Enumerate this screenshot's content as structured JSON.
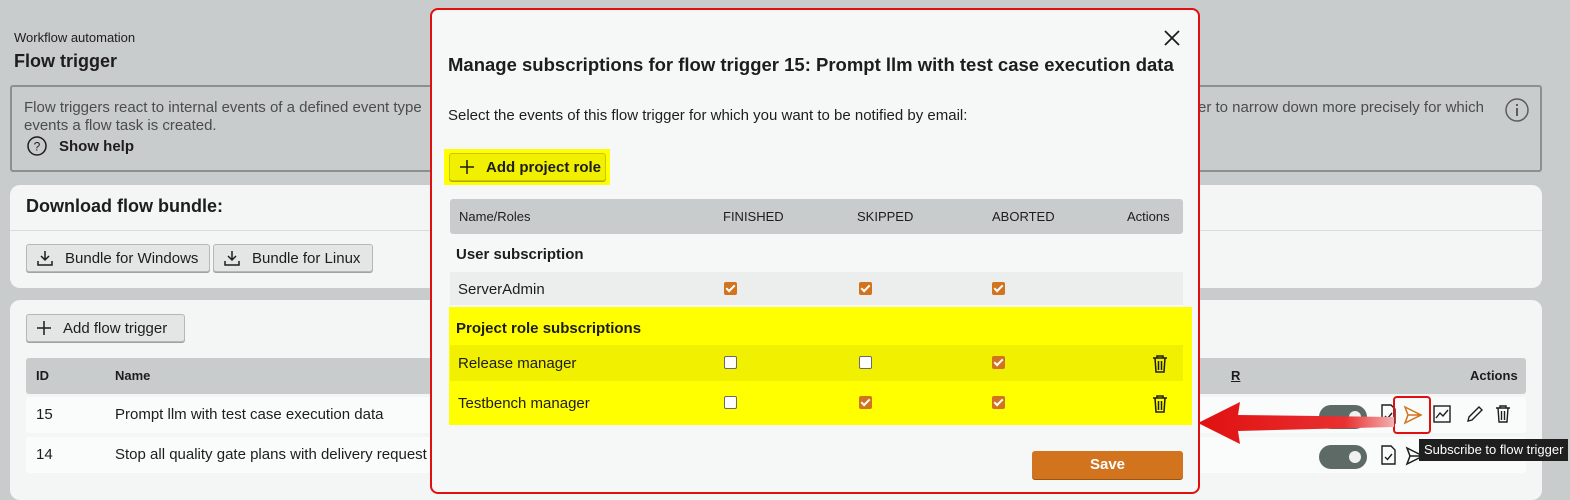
{
  "page": {
    "breadcrumb": "Workflow automation",
    "title": "Flow trigger",
    "info_text_line1_left": "Flow triggers react to internal events of a defined event type",
    "info_text_line1_right": "er to narrow down more precisely for which",
    "info_text_line2": "events a flow task is created.",
    "show_help": "Show help"
  },
  "download": {
    "heading": "Download flow bundle:",
    "windows_label": "Bundle for Windows",
    "linux_label": "Bundle for Linux"
  },
  "triggers": {
    "add_label": "Add flow trigger",
    "columns": {
      "id": "ID",
      "name": "Name",
      "r": "R",
      "actions": "Actions"
    },
    "rows": [
      {
        "id": "15",
        "name": "Prompt llm with test case execution data"
      },
      {
        "id": "14",
        "name": "Stop all quality gate plans with delivery request"
      }
    ],
    "tooltip": "Subscribe to flow trigger"
  },
  "modal": {
    "title": "Manage subscriptions for flow trigger 15: Prompt llm with test case execution data",
    "subtitle": "Select the events of this flow trigger for which you want to be notified by email:",
    "add_role_label": "Add project role",
    "columns": {
      "name": "Name/Roles",
      "finished": "FINISHED",
      "skipped": "SKIPPED",
      "aborted": "ABORTED",
      "actions": "Actions"
    },
    "user_section": "User subscription",
    "user_rows": [
      {
        "name": "ServerAdmin",
        "finished": true,
        "skipped": true,
        "aborted": true
      }
    ],
    "role_section": "Project role subscriptions",
    "role_rows": [
      {
        "name": "Release manager",
        "finished": false,
        "skipped": false,
        "aborted": true
      },
      {
        "name": "Testbench manager",
        "finished": false,
        "skipped": true,
        "aborted": true
      }
    ],
    "save_label": "Save"
  },
  "colors": {
    "accent": "#d2731d",
    "highlight": "#ffff00",
    "annotation_red": "#e01010",
    "background": "#c9cccc"
  }
}
